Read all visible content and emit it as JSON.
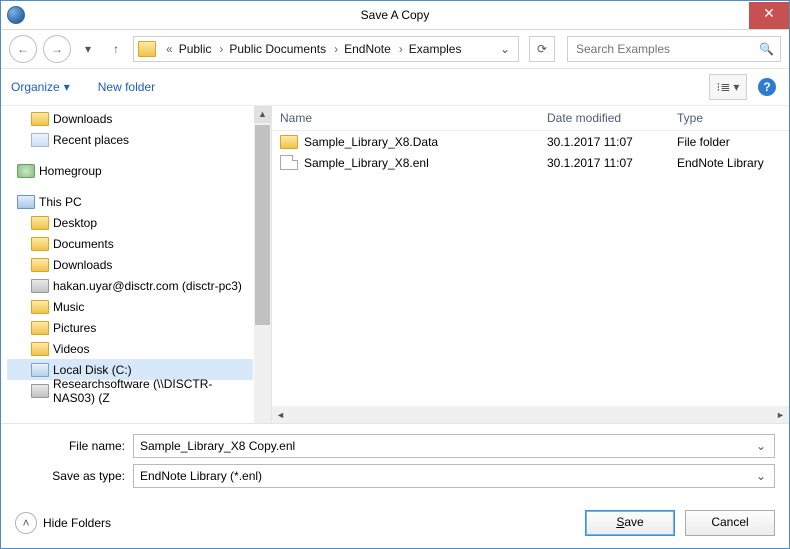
{
  "window": {
    "title": "Save A Copy"
  },
  "nav": {
    "back": "←",
    "forward": "→",
    "up": "↑",
    "refresh": "⟳",
    "breadcrumb_prefix": "«",
    "crumbs": [
      "Public",
      "Public Documents",
      "EndNote",
      "Examples"
    ],
    "dropdown_glyph": "⌄",
    "sep_glyph": "›"
  },
  "search": {
    "placeholder": "Search Examples",
    "icon": "🔍"
  },
  "toolbar": {
    "organize": "Organize",
    "organize_drop": "▾",
    "new_folder": "New folder",
    "view_glyph": "⁝≣",
    "help_glyph": "?"
  },
  "tree": {
    "favorites_children": [
      {
        "icon": "folder",
        "label": "Downloads"
      },
      {
        "icon": "recent",
        "label": "Recent places"
      }
    ],
    "groups": [
      {
        "icon": "home",
        "label": "Homegroup",
        "children": []
      },
      {
        "icon": "pc",
        "label": "This PC",
        "children": [
          {
            "icon": "folder",
            "label": "Desktop"
          },
          {
            "icon": "folder",
            "label": "Documents"
          },
          {
            "icon": "folder",
            "label": "Downloads"
          },
          {
            "icon": "net",
            "label": "hakan.uyar@disctr.com (disctr-pc3)"
          },
          {
            "icon": "folder",
            "label": "Music"
          },
          {
            "icon": "folder",
            "label": "Pictures"
          },
          {
            "icon": "folder",
            "label": "Videos"
          },
          {
            "icon": "disk",
            "label": "Local Disk (C:)",
            "selected": true
          },
          {
            "icon": "net",
            "label": "Researchsoftware (\\\\DISCTR-NAS03) (Z"
          }
        ]
      }
    ]
  },
  "list": {
    "headers": {
      "name": "Name",
      "date": "Date modified",
      "type": "Type"
    },
    "rows": [
      {
        "icon": "folder",
        "name": "Sample_Library_X8.Data",
        "date": "30.1.2017 11:07",
        "type": "File folder"
      },
      {
        "icon": "doc",
        "name": "Sample_Library_X8.enl",
        "date": "30.1.2017 11:07",
        "type": "EndNote Library"
      }
    ]
  },
  "form": {
    "filename_label": "File name:",
    "filename_value": "Sample_Library_X8 Copy.enl",
    "type_label": "Save as type:",
    "type_value": "EndNote Library (*.enl)"
  },
  "footer": {
    "hide_folders": "Hide Folders",
    "hf_glyph": "˄",
    "save": "Save",
    "cancel": "Cancel"
  }
}
